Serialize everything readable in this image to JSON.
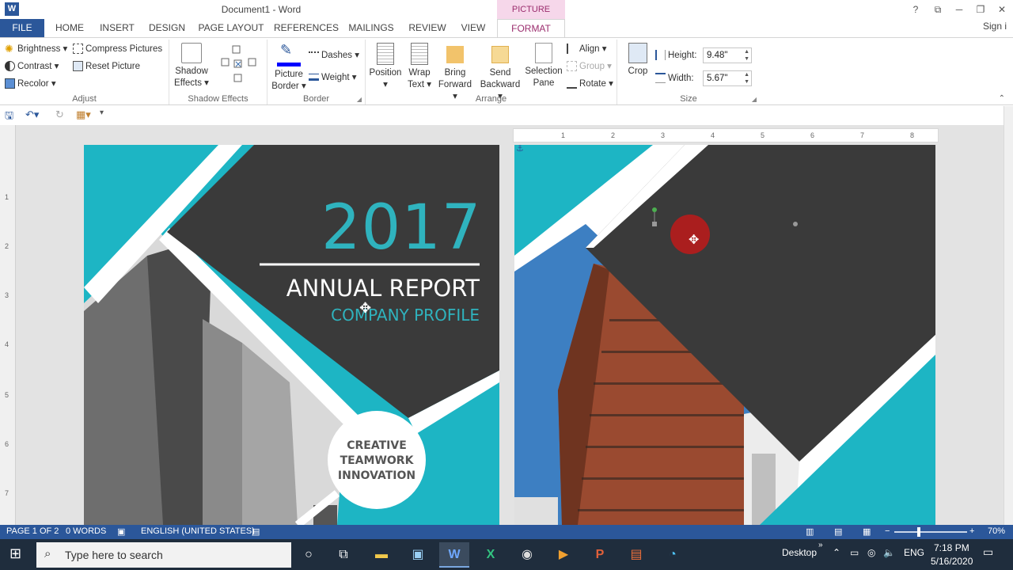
{
  "titlebar": {
    "word_logo": "W",
    "title": "Document1 - Word",
    "contextual_tab_group": "PICTURE TOOLS",
    "help": "?",
    "restore_ribbon": "⧉",
    "minimize": "─",
    "maximize": "❐",
    "close": "✕"
  },
  "tabs": [
    "FILE",
    "HOME",
    "INSERT",
    "DESIGN",
    "PAGE LAYOUT",
    "REFERENCES",
    "MAILINGS",
    "REVIEW",
    "VIEW",
    "FORMAT"
  ],
  "sign_in": "Sign i",
  "ribbon": {
    "adjust": {
      "label": "Adjust",
      "brightness": "Brightness",
      "contrast": "Contrast",
      "recolor": "Recolor",
      "compress": "Compress Pictures",
      "reset": "Reset Picture"
    },
    "shadow_effects": {
      "label": "Shadow Effects",
      "button_line1": "Shadow",
      "button_line2": "Effects"
    },
    "border": {
      "label": "Border",
      "picture_border_line1": "Picture",
      "picture_border_line2": "Border",
      "dashes": "Dashes",
      "weight": "Weight"
    },
    "arrange": {
      "label": "Arrange",
      "position": "Position",
      "wrap_line1": "Wrap",
      "wrap_line2": "Text",
      "bring_line1": "Bring",
      "bring_line2": "Forward",
      "send_line1": "Send",
      "send_line2": "Backward",
      "selection_line1": "Selection",
      "selection_line2": "Pane",
      "align": "Align",
      "group": "Group",
      "rotate": "Rotate"
    },
    "size": {
      "label": "Size",
      "crop": "Crop",
      "height_label": "Height:",
      "height_value": "9.48\"",
      "width_label": "Width:",
      "width_value": "5.67\""
    }
  },
  "ruler": {
    "h_ticks": [
      "1",
      "2",
      "3",
      "4",
      "5",
      "6",
      "7",
      "8"
    ],
    "v_ticks": [
      "1",
      "2",
      "3",
      "4",
      "5",
      "6",
      "7"
    ]
  },
  "cover": {
    "year": "2017",
    "title": "ANNUAL REPORT",
    "subtitle": "COMPANY PROFILE",
    "circle_lines": [
      "CREATIVE",
      "TEAMWORK",
      "INNOVATION"
    ]
  },
  "status": {
    "page": "PAGE 1 OF 2",
    "words": "0 WORDS",
    "language": "ENGLISH (UNITED STATES)",
    "zoom_minus": "−",
    "zoom_plus": "+",
    "zoom": "70%",
    "zoom_level": 0.7
  },
  "taskbar": {
    "search_placeholder": "Type here to search",
    "desktop": "Desktop",
    "lang": "ENG",
    "time": "7:18 PM",
    "date": "5/16/2020"
  },
  "colors": {
    "word_blue": "#2b579a",
    "teal": "#1db5c4",
    "dark": "#3a3a3a",
    "format_accent": "#9b2d6e"
  }
}
